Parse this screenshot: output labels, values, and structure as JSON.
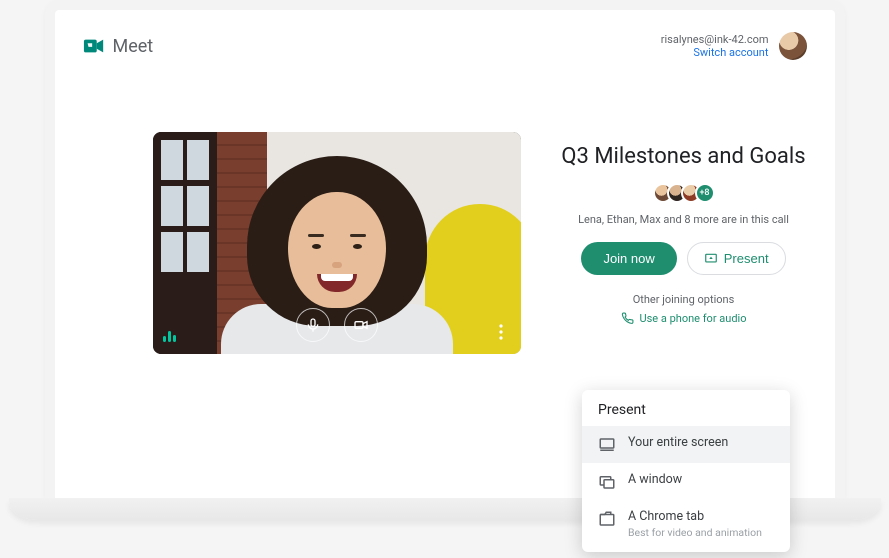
{
  "brand": {
    "name": "Meet"
  },
  "account": {
    "email": "risalynes@ink-42.com",
    "switch_label": "Switch account"
  },
  "video": {
    "mic_icon": "mic-icon",
    "camera_icon": "camera-icon",
    "more_icon": "more-vertical-icon",
    "audio_indicator": "audio-level-icon"
  },
  "meeting": {
    "title": "Q3 Milestones and Goals",
    "more_count": "+8",
    "in_call_text": "Lena, Ethan, Max and 8 more are in this call",
    "join_label": "Join now",
    "present_label": "Present",
    "other_options_label": "Other joining options",
    "phone_label": "Use a phone for audio"
  },
  "present_popup": {
    "title": "Present",
    "items": [
      {
        "label": "Your entire screen",
        "sub": "",
        "icon": "monitor-icon"
      },
      {
        "label": "A window",
        "sub": "",
        "icon": "window-icon"
      },
      {
        "label": "A Chrome tab",
        "sub": "Best for video and animation",
        "icon": "tab-icon"
      }
    ]
  }
}
